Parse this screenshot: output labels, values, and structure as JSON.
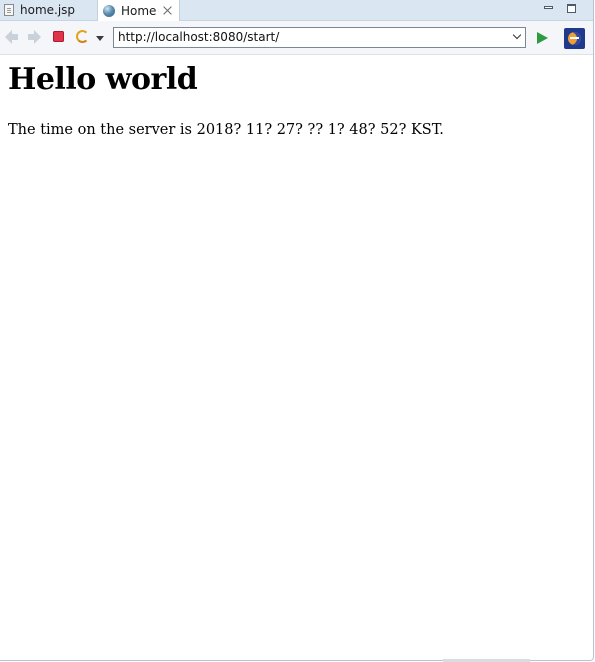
{
  "tabs": [
    {
      "label": "home.jsp",
      "icon": "file-icon"
    },
    {
      "label": "Home",
      "icon": "globe-icon",
      "active": true
    }
  ],
  "toolbar": {
    "address": "http://localhost:8080/start/"
  },
  "page": {
    "heading": "Hello world",
    "text": "The time on the server is 2018? 11? 27? ?? 1? 48? 52? KST."
  },
  "colors": {
    "tab_strip": "#dbe6f3",
    "stop": "#e0344a",
    "go": "#2f9a44",
    "refresh": "#e5a21e"
  }
}
